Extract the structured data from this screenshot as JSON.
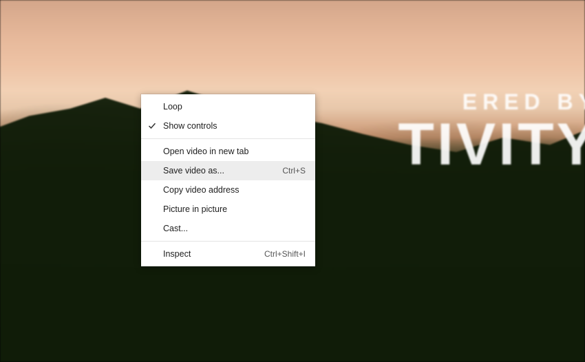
{
  "video_overlay": {
    "line1": "ERED BY",
    "line2": "TIVITY"
  },
  "context_menu": {
    "groups": [
      [
        {
          "id": "loop",
          "label": "Loop",
          "checked": false,
          "shortcut": "",
          "hovered": false
        },
        {
          "id": "show-controls",
          "label": "Show controls",
          "checked": true,
          "shortcut": "",
          "hovered": false
        }
      ],
      [
        {
          "id": "open-new-tab",
          "label": "Open video in new tab",
          "checked": false,
          "shortcut": "",
          "hovered": false
        },
        {
          "id": "save-as",
          "label": "Save video as...",
          "checked": false,
          "shortcut": "Ctrl+S",
          "hovered": true
        },
        {
          "id": "copy-address",
          "label": "Copy video address",
          "checked": false,
          "shortcut": "",
          "hovered": false
        },
        {
          "id": "pip",
          "label": "Picture in picture",
          "checked": false,
          "shortcut": "",
          "hovered": false
        },
        {
          "id": "cast",
          "label": "Cast...",
          "checked": false,
          "shortcut": "",
          "hovered": false
        }
      ],
      [
        {
          "id": "inspect",
          "label": "Inspect",
          "checked": false,
          "shortcut": "Ctrl+Shift+I",
          "hovered": false
        }
      ]
    ]
  }
}
